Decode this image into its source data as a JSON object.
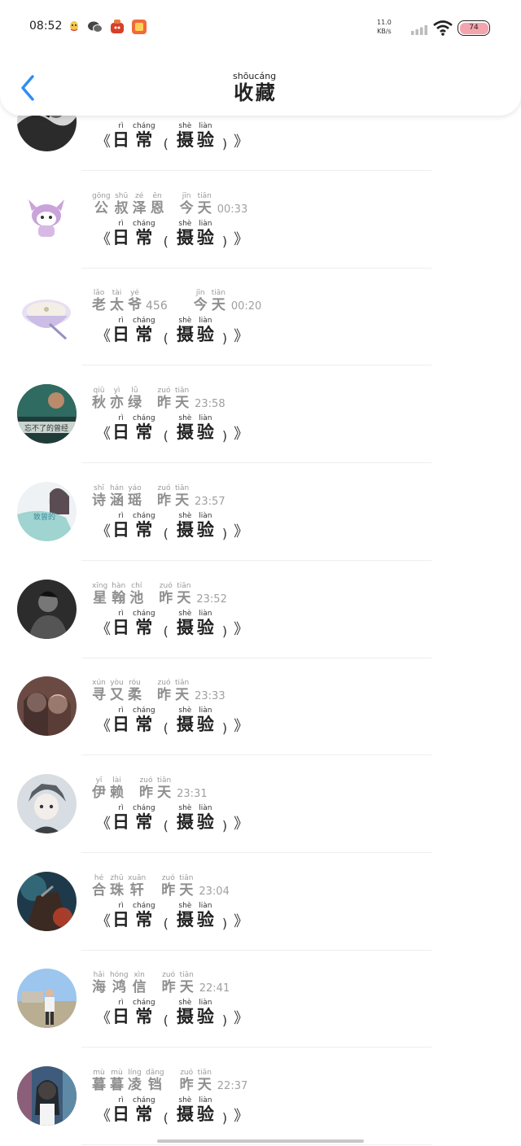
{
  "status_bar": {
    "time": "08:52",
    "net_speed": "11.0",
    "net_unit": "KB/s",
    "battery": "74",
    "battery_color": "#f4a4ad",
    "notification_icons": [
      "qq-icon",
      "wechat-icon",
      "app-red-icon",
      "app-orange-icon"
    ]
  },
  "header": {
    "back_icon": "chevron-left-icon",
    "title": [
      {
        "char": "收",
        "pinyin": "shōu"
      },
      {
        "char": "藏",
        "pinyin": "cáng"
      }
    ],
    "accent_color": "#2f8cf5"
  },
  "caption": {
    "open": "《",
    "close": "》",
    "paren_open": "(",
    "paren_close": ")",
    "word1": [
      {
        "char": "日",
        "pinyin": "rì"
      },
      {
        "char": "常",
        "pinyin": "cháng"
      }
    ],
    "word2": [
      {
        "char": "摄",
        "pinyin": "shè"
      },
      {
        "char": "验",
        "pinyin": "liàn"
      }
    ]
  },
  "items": [
    {
      "avatar": "avatar-bw-photo",
      "name": [],
      "name_suffix": "",
      "date": [],
      "time": ""
    },
    {
      "avatar": "avatar-kuromi",
      "name": [
        {
          "char": "公",
          "pinyin": "gōng"
        },
        {
          "char": "叔",
          "pinyin": "shū"
        },
        {
          "char": "泽",
          "pinyin": "zé"
        },
        {
          "char": "恩",
          "pinyin": "ēn"
        }
      ],
      "name_suffix": "",
      "date": [
        {
          "char": "今",
          "pinyin": "jīn"
        },
        {
          "char": "天",
          "pinyin": "tiān"
        }
      ],
      "time": "00:33"
    },
    {
      "avatar": "avatar-soup-bowl",
      "name": [
        {
          "char": "老",
          "pinyin": "lǎo"
        },
        {
          "char": "太",
          "pinyin": "tài"
        },
        {
          "char": "爷",
          "pinyin": "yé"
        }
      ],
      "name_suffix": "456",
      "date": [
        {
          "char": "今",
          "pinyin": "jīn"
        },
        {
          "char": "天",
          "pinyin": "tiān"
        }
      ],
      "time": "00:20"
    },
    {
      "avatar": "avatar-teal-photo",
      "avatar_text": "忘不了的曾经",
      "name": [
        {
          "char": "秋",
          "pinyin": "qiū"
        },
        {
          "char": "亦",
          "pinyin": "yì"
        },
        {
          "char": "绿",
          "pinyin": "lǜ"
        }
      ],
      "name_suffix": "",
      "date": [
        {
          "char": "昨",
          "pinyin": "zuó"
        },
        {
          "char": "天",
          "pinyin": "tiān"
        }
      ],
      "time": "23:58"
    },
    {
      "avatar": "avatar-girl-flowers",
      "avatar_text": "致曾的",
      "name": [
        {
          "char": "诗",
          "pinyin": "shī"
        },
        {
          "char": "涵",
          "pinyin": "hán"
        },
        {
          "char": "瑶",
          "pinyin": "yáo"
        }
      ],
      "name_suffix": "",
      "date": [
        {
          "char": "昨",
          "pinyin": "zuó"
        },
        {
          "char": "天",
          "pinyin": "tiān"
        }
      ],
      "time": "23:57"
    },
    {
      "avatar": "avatar-dark-man",
      "name": [
        {
          "char": "星",
          "pinyin": "xīng"
        },
        {
          "char": "翰",
          "pinyin": "hàn"
        },
        {
          "char": "池",
          "pinyin": "chí"
        }
      ],
      "name_suffix": "",
      "date": [
        {
          "char": "昨",
          "pinyin": "zuó"
        },
        {
          "char": "天",
          "pinyin": "tiān"
        }
      ],
      "time": "23:52"
    },
    {
      "avatar": "avatar-two-girls",
      "name": [
        {
          "char": "寻",
          "pinyin": "xún"
        },
        {
          "char": "又",
          "pinyin": "yòu"
        },
        {
          "char": "柔",
          "pinyin": "róu"
        }
      ],
      "name_suffix": "",
      "date": [
        {
          "char": "昨",
          "pinyin": "zuó"
        },
        {
          "char": "天",
          "pinyin": "tiān"
        }
      ],
      "time": "23:33"
    },
    {
      "avatar": "avatar-anime-boy",
      "name": [
        {
          "char": "伊",
          "pinyin": "yī"
        },
        {
          "char": "赖",
          "pinyin": "lài"
        }
      ],
      "name_suffix": "",
      "date": [
        {
          "char": "昨",
          "pinyin": "zuó"
        },
        {
          "char": "天",
          "pinyin": "tiān"
        }
      ],
      "time": "23:31"
    },
    {
      "avatar": "avatar-warrior",
      "name": [
        {
          "char": "合",
          "pinyin": "hé"
        },
        {
          "char": "珠",
          "pinyin": "zhū"
        },
        {
          "char": "轩",
          "pinyin": "xuān"
        }
      ],
      "name_suffix": "",
      "date": [
        {
          "char": "昨",
          "pinyin": "zuó"
        },
        {
          "char": "天",
          "pinyin": "tiān"
        }
      ],
      "time": "23:04"
    },
    {
      "avatar": "avatar-man-outdoors",
      "name": [
        {
          "char": "海",
          "pinyin": "hǎi"
        },
        {
          "char": "鸿",
          "pinyin": "hóng"
        },
        {
          "char": "信",
          "pinyin": "xìn"
        }
      ],
      "name_suffix": "",
      "date": [
        {
          "char": "昨",
          "pinyin": "zuó"
        },
        {
          "char": "天",
          "pinyin": "tiān"
        }
      ],
      "time": "22:41"
    },
    {
      "avatar": "avatar-girl-store",
      "name": [
        {
          "char": "暮",
          "pinyin": "mù"
        },
        {
          "char": "暮",
          "pinyin": "mù"
        },
        {
          "char": "凌",
          "pinyin": "líng"
        },
        {
          "char": "铛",
          "pinyin": "dāng"
        }
      ],
      "name_suffix": "",
      "date": [
        {
          "char": "昨",
          "pinyin": "zuó"
        },
        {
          "char": "天",
          "pinyin": "tiān"
        }
      ],
      "time": "22:37"
    }
  ]
}
